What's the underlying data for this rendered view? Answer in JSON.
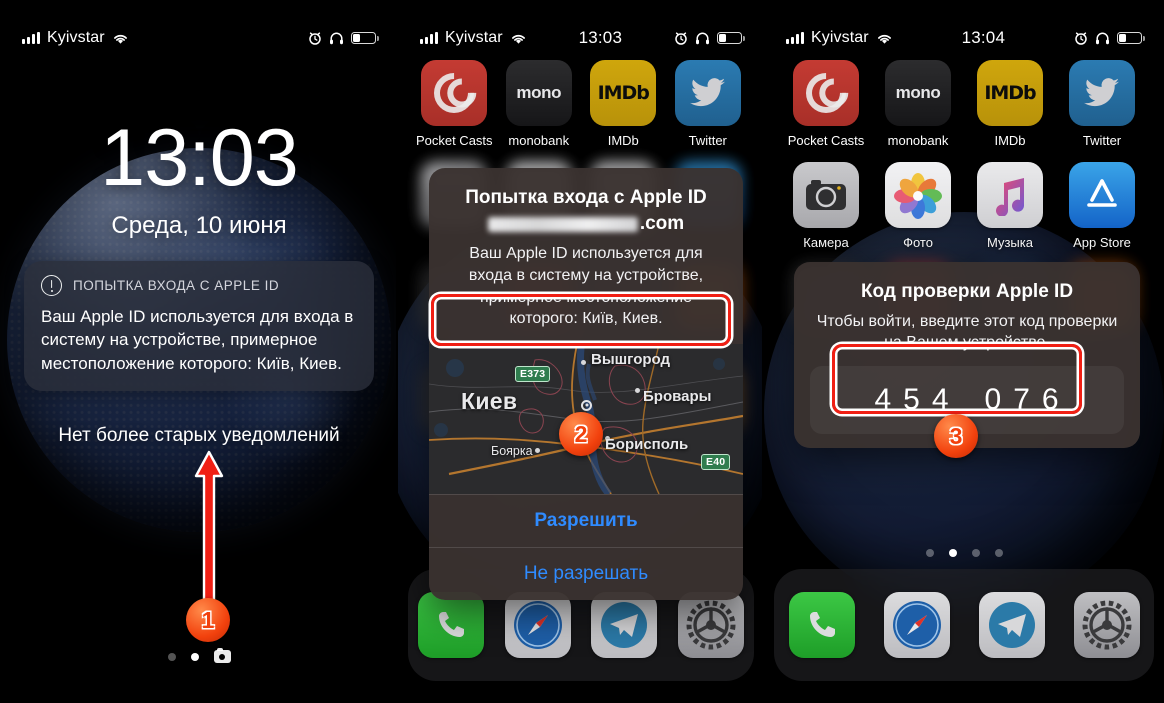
{
  "panels": [
    {
      "id": "lock-screen",
      "statusbar": {
        "carrier": "Kyivstar",
        "time": "",
        "icons": [
          "signal-bars-icon",
          "wifi-icon",
          "alarm-clock-icon",
          "headphones-icon",
          "battery-icon"
        ]
      },
      "lock": {
        "time": "13:03",
        "date": "Среда, 10 июня",
        "notification": {
          "app_title": "ПОПЫТКА ВХОДА С APPLE ID",
          "body": "Ваш Apple ID используется для входа в систему на устройстве, примерное местоположение которого: Киïв, Киев."
        },
        "no_older": "Нет более старых уведомлений",
        "dots": [
          {
            "type": "dot",
            "active": false
          },
          {
            "type": "dot",
            "active": true
          },
          {
            "type": "camera",
            "active": false
          }
        ]
      },
      "badge": "1"
    },
    {
      "id": "allow-dialog",
      "statusbar": {
        "carrier": "Kyivstar",
        "time": "13:03",
        "icons": [
          "signal-bars-icon",
          "wifi-icon",
          "alarm-clock-icon",
          "headphones-icon",
          "battery-icon"
        ]
      },
      "apps_row": [
        {
          "label": "Pocket Casts",
          "icon": "pocket-casts-icon"
        },
        {
          "label": "monobank",
          "icon": "monobank-icon",
          "glyph": "mono"
        },
        {
          "label": "IMDb",
          "icon": "imdb-icon",
          "glyph": "IMDb"
        },
        {
          "label": "Twitter",
          "icon": "twitter-icon"
        }
      ],
      "dialog": {
        "title": "Попытка входа с Apple ID",
        "email_suffix": ".com",
        "body": "Ваш Apple ID используется для входа в систему на устройстве, примерное местоположение которого: Киïв, Киев.",
        "map": {
          "labels": [
            {
              "text": "Вышгород",
              "kind": "city"
            },
            {
              "text": "Киев",
              "kind": "city-major"
            },
            {
              "text": "Бровары",
              "kind": "city"
            },
            {
              "text": "Борисполь",
              "kind": "city"
            },
            {
              "text": "Боярка",
              "kind": "town"
            }
          ],
          "shields": [
            "E373",
            "E40"
          ]
        },
        "allow_label": "Разрешить",
        "deny_label": "Не разрешать"
      },
      "dock": [
        {
          "label": "Телефон",
          "icon": "phone-icon"
        },
        {
          "label": "Safari",
          "icon": "safari-icon"
        },
        {
          "label": "Telegram",
          "icon": "telegram-icon"
        },
        {
          "label": "Настройки",
          "icon": "settings-gear-icon"
        }
      ],
      "badge": "2"
    },
    {
      "id": "code-dialog",
      "statusbar": {
        "carrier": "Kyivstar",
        "time": "13:04",
        "icons": [
          "signal-bars-icon",
          "wifi-icon",
          "alarm-clock-icon",
          "headphones-icon",
          "battery-icon"
        ]
      },
      "apps_row_1": [
        {
          "label": "Pocket Casts",
          "icon": "pocket-casts-icon"
        },
        {
          "label": "monobank",
          "icon": "monobank-icon",
          "glyph": "mono"
        },
        {
          "label": "IMDb",
          "icon": "imdb-icon",
          "glyph": "IMDb"
        },
        {
          "label": "Twitter",
          "icon": "twitter-icon"
        }
      ],
      "apps_row_2": [
        {
          "label": "Камера",
          "icon": "camera-icon"
        },
        {
          "label": "Фото",
          "icon": "photos-icon"
        },
        {
          "label": "Музыка",
          "icon": "music-icon"
        },
        {
          "label": "App Store",
          "icon": "app-store-icon"
        }
      ],
      "dialog": {
        "title": "Код проверки Apple ID",
        "body": "Чтобы войти, введите этот код проверки на Вашем устройстве.",
        "code": [
          "4",
          "5",
          "4",
          "0",
          "7",
          "6"
        ]
      },
      "dots": [
        {
          "type": "dot",
          "active": false
        },
        {
          "type": "dot",
          "active": true
        },
        {
          "type": "dot",
          "active": false
        },
        {
          "type": "dot",
          "active": false
        }
      ],
      "dock": [
        {
          "label": "Телефон",
          "icon": "phone-icon"
        },
        {
          "label": "Safari",
          "icon": "safari-icon"
        },
        {
          "label": "Telegram",
          "icon": "telegram-icon"
        },
        {
          "label": "Настройки",
          "icon": "settings-gear-icon"
        }
      ],
      "badge": "3"
    }
  ],
  "colors": {
    "annotation_red": "#f01f14",
    "badge_orange": "#f2410d",
    "ios_blue": "#2f8bff"
  }
}
